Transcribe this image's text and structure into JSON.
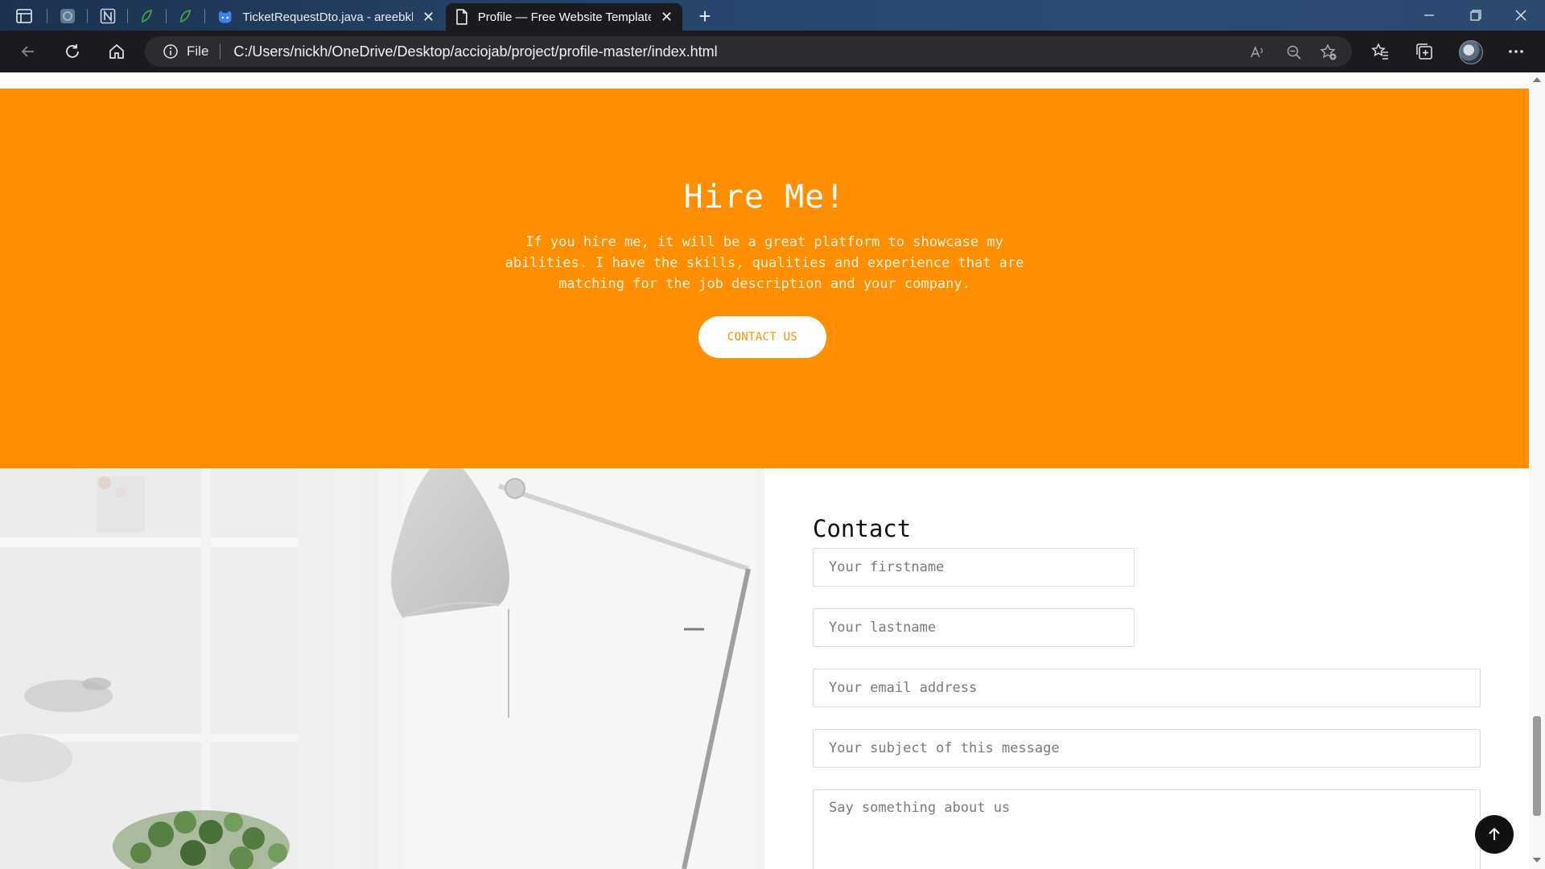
{
  "browser": {
    "tabs": [
      {
        "title": "TicketRequestDto.java - areebkhan",
        "icon": "github-icon"
      },
      {
        "title": "Profile — Free Website Template",
        "icon": "page-icon",
        "active": true
      }
    ],
    "address": {
      "scheme_label": "File",
      "url": "C:/Users/nickh/OneDrive/Desktop/acciojab/project/profile-master/index.html"
    },
    "tab_close_glyph": "✕",
    "new_tab_glyph": "+"
  },
  "page": {
    "hire": {
      "title": "Hire Me!",
      "text": "If you hire me, it will be a great platform to showcase my abilities. I have the skills, qualities and experience that are matching for the job description and your company.",
      "button": "CONTACT US",
      "background": "#ff8e00"
    },
    "contact": {
      "title": "Contact",
      "firstname_placeholder": "Your firstname",
      "lastname_placeholder": "Your lastname",
      "email_placeholder": "Your email address",
      "subject_placeholder": "Your subject of this message",
      "message_placeholder": "Say something about us"
    }
  }
}
